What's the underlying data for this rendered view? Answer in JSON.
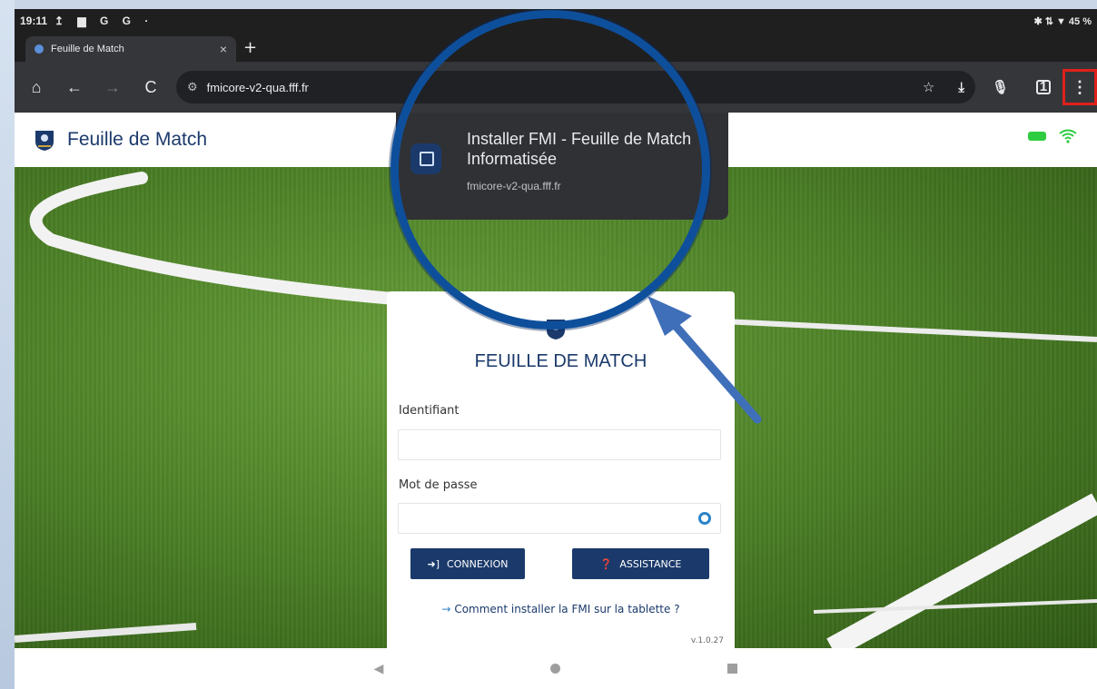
{
  "status_bar": {
    "time": "19:11",
    "left_icons": "↥ ▆ G G ·",
    "right_text": "✱ ⇅ ▼ 45 %"
  },
  "browser": {
    "tab_title": "Feuille de Match",
    "tab_close": "×",
    "new_tab": "+",
    "url": "fmicore-v2-qua.fff.fr",
    "home_icon": "⌂",
    "back_icon": "←",
    "forward_icon": "→",
    "reload_icon": "C",
    "menu_icon": "⋮"
  },
  "page": {
    "header_title": "Feuille de Match"
  },
  "install_popup": {
    "title": "Installer FMI - Feuille de Match Informatisée",
    "domain": "fmicore-v2-qua.fff.fr"
  },
  "login": {
    "title": "FEUILLE DE MATCH",
    "username_label": "Identifiant",
    "username_value": "",
    "password_label": "Mot de passe",
    "password_value": "",
    "connect_label": "CONNEXION",
    "assist_label": "ASSISTANCE",
    "help_link": "Comment installer la FMI sur la tablette ?",
    "version": "v.1.0.27"
  },
  "colors": {
    "brand": "#1b3a6b",
    "accent": "#2b83c8",
    "highlight": "#e0201b",
    "magnifier": "#0e4f9c"
  }
}
